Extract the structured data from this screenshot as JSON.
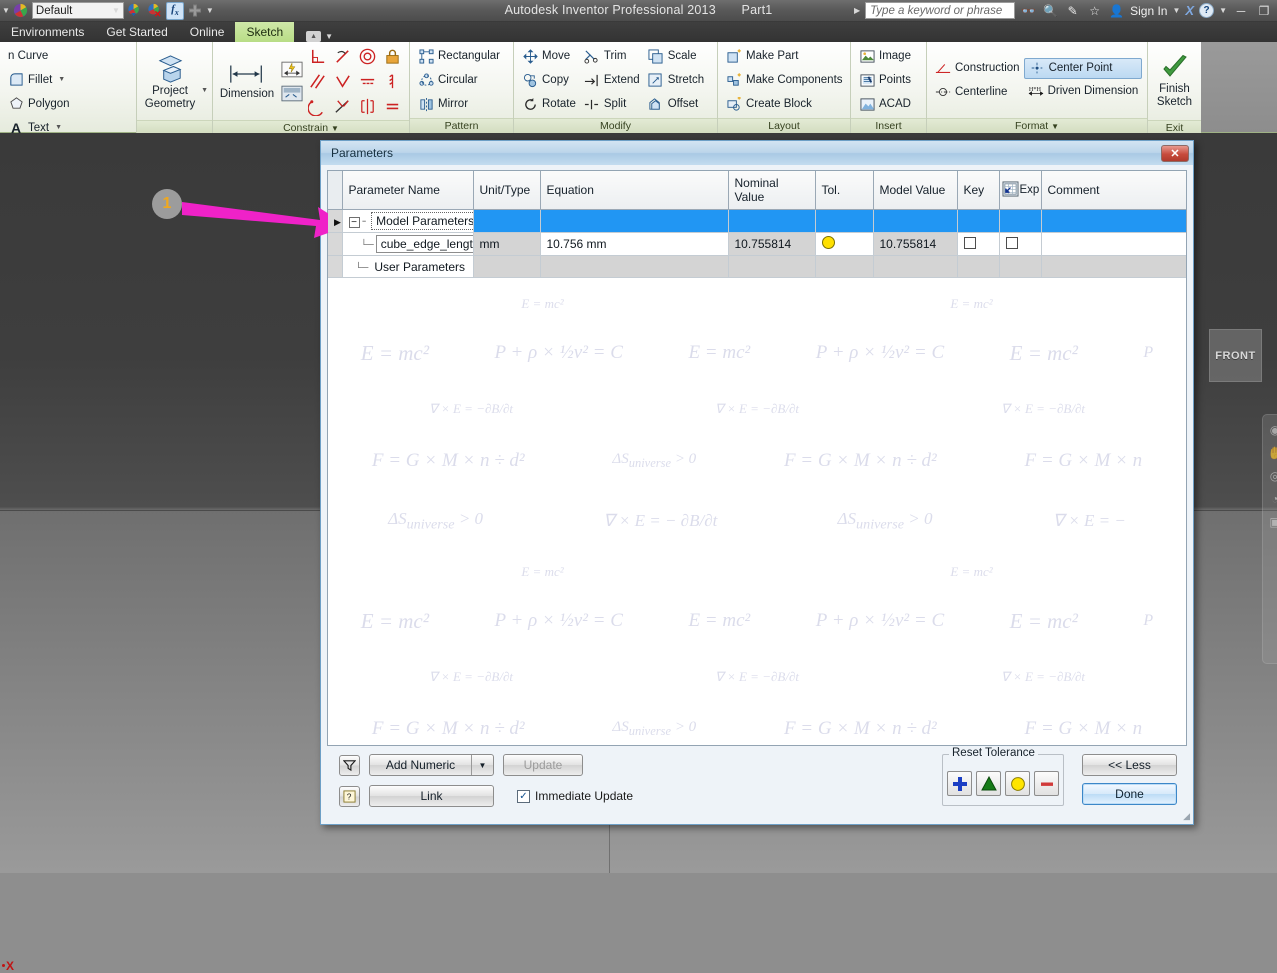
{
  "titlebar": {
    "app_title": "Autodesk Inventor Professional 2013",
    "document_name": "Part1",
    "profile_value": "Default",
    "search_placeholder": "Type a keyword or phrase",
    "signin_label": "Sign In",
    "icons": [
      "color-wheel-icon",
      "appearance-icon",
      "adjust-appearance-icon",
      "fx-parameters-icon",
      "add-plus-icon",
      "dropdown-arrow-icon"
    ],
    "right_icons": [
      "binoculars-icon",
      "search-help-icon",
      "feedback-icon",
      "favorites-star-icon",
      "user-icon",
      "exchange-x-icon",
      "help-question-icon"
    ],
    "window_buttons": [
      "minimize-icon",
      "restore-icon"
    ]
  },
  "ribbon_tabs": {
    "items": [
      {
        "label": "Environments",
        "active": false
      },
      {
        "label": "Get Started",
        "active": false
      },
      {
        "label": "Online",
        "active": false
      },
      {
        "label": "Sketch",
        "active": true
      }
    ]
  },
  "ribbon": {
    "panels": [
      {
        "title": "",
        "items": [
          "n Curve",
          "Fillet",
          "Polygon",
          "Text"
        ]
      },
      {
        "title": "",
        "items": [
          "Project Geometry"
        ]
      },
      {
        "title": "Constrain",
        "items": [
          "Dimension"
        ]
      },
      {
        "title": "Pattern",
        "items": [
          "Rectangular",
          "Circular",
          "Mirror"
        ]
      },
      {
        "title": "Modify",
        "items": [
          "Move",
          "Trim",
          "Scale",
          "Copy",
          "Extend",
          "Stretch",
          "Rotate",
          "Split",
          "Offset"
        ]
      },
      {
        "title": "Layout",
        "items": [
          "Make Part",
          "Make Components",
          "Create Block"
        ]
      },
      {
        "title": "Insert",
        "items": [
          "Image",
          "Points",
          "ACAD"
        ]
      },
      {
        "title": "Format",
        "items": [
          "Construction",
          "Center Point",
          "Centerline",
          "Driven Dimension"
        ]
      },
      {
        "title": "Exit",
        "items": [
          "Finish Sketch"
        ]
      }
    ],
    "labels": {
      "curve": "n Curve",
      "fillet": "Fillet",
      "polygon": "Polygon",
      "text": "Text",
      "project_geometry_l1": "Project",
      "project_geometry_l2": "Geometry",
      "dimension": "Dimension",
      "rectangular": "Rectangular",
      "circular": "Circular",
      "mirror": "Mirror",
      "move": "Move",
      "copy": "Copy",
      "rotate": "Rotate",
      "trim": "Trim",
      "extend": "Extend",
      "split": "Split",
      "scale": "Scale",
      "stretch": "Stretch",
      "offset": "Offset",
      "make_part": "Make Part",
      "make_components": "Make Components",
      "create_block": "Create Block",
      "image": "Image",
      "points": "Points",
      "acad": "ACAD",
      "construction": "Construction",
      "centerline": "Centerline",
      "center_point": "Center Point",
      "driven_dimension": "Driven Dimension",
      "finish_sketch_l1": "Finish",
      "finish_sketch_l2": "Sketch"
    },
    "panel_titles": {
      "constrain": "Constrain",
      "pattern": "Pattern",
      "modify": "Modify",
      "layout": "Layout",
      "insert": "Insert",
      "format": "Format",
      "exit": "Exit"
    }
  },
  "viewport": {
    "viewcube_label": "FRONT",
    "axis_label": "X",
    "nav_icons": [
      "full-navigation-wheel-icon",
      "pan-hand-icon",
      "zoom-icon",
      "orbit-icon",
      "look-at-icon"
    ]
  },
  "dialog": {
    "title": "Parameters",
    "close_label": "✕",
    "columns": [
      "Parameter Name",
      "Unit/Type",
      "Equation",
      "Nominal Value",
      "Tol.",
      "Model Value",
      "Key",
      "Exp",
      "Comment"
    ],
    "rows": [
      {
        "kind": "group",
        "name": "Model Parameters",
        "unit": "",
        "equation": "",
        "nominal": "",
        "model": "",
        "comment": ""
      },
      {
        "kind": "data",
        "name": "cube_edge_length",
        "unit": "mm",
        "equation": "10.756 mm",
        "nominal": "10.755814",
        "model": "10.755814",
        "comment": ""
      },
      {
        "kind": "group",
        "name": "User Parameters",
        "unit": "",
        "equation": "",
        "nominal": "",
        "model": "",
        "comment": ""
      }
    ],
    "footer": {
      "filter_icon": "filter-funnel-icon",
      "help_icon": "help-question-icon",
      "add_numeric_label": "Add Numeric",
      "add_numeric_arrow": "▼",
      "update_label": "Update",
      "link_label": "Link",
      "immediate_update_label": "Immediate Update",
      "immediate_update_checked": "✓",
      "reset_tolerance_label": "Reset Tolerance",
      "tolerance_buttons": [
        "plus-tolerance-icon",
        "triangle-tolerance-icon",
        "circle-tolerance-icon",
        "minus-tolerance-icon"
      ],
      "less_label": "<< Less",
      "done_label": "Done"
    }
  },
  "annotation": {
    "badge_number": "1",
    "arrow_color": "#ef22c8",
    "badge_bg": "#9c9c9c",
    "badge_fg": "#f0a81e"
  },
  "colors": {
    "selected_row": "#2196f3",
    "ribbon_active_tab": "#b8dd86",
    "dialog_border": "#6d9fc6",
    "tolerance_yellow": "#ffe000"
  }
}
